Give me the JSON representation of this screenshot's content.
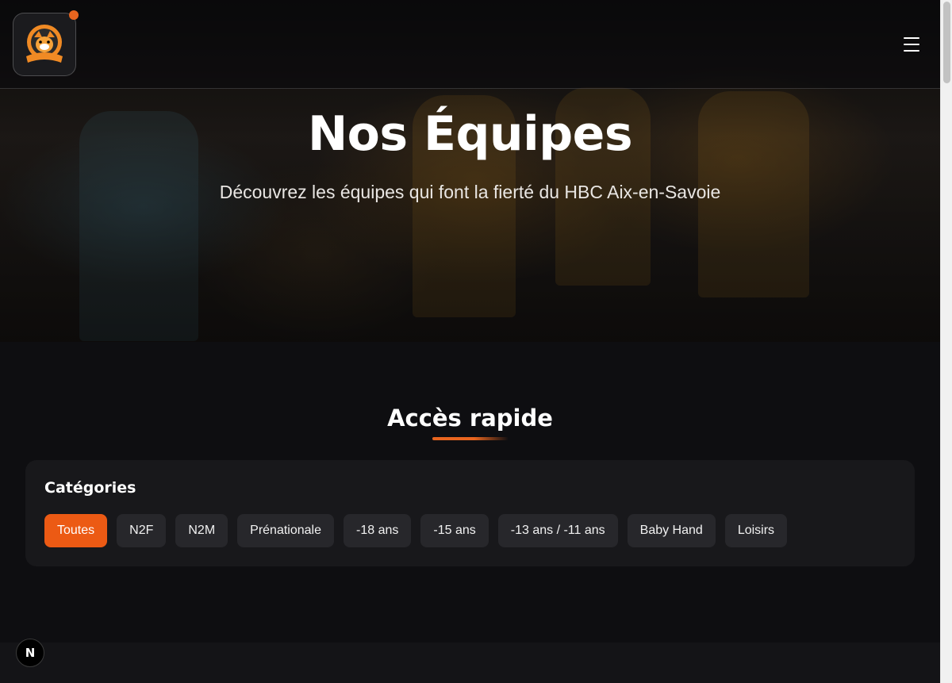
{
  "header": {
    "logo_icon": "tiger-club-logo-icon",
    "menu_icon": "hamburger-menu-icon"
  },
  "hero": {
    "title": "Nos Équipes",
    "subtitle": "Découvrez les équipes qui font la fierté du HBC Aix-en-Savoie"
  },
  "quick_access": {
    "title": "Accès rapide",
    "categories_label": "Catégories",
    "categories": [
      "Toutes",
      "N2F",
      "N2M",
      "Prénationale",
      "-18 ans",
      "-15 ans",
      "-13 ans / -11 ans",
      "Baby Hand",
      "Loisirs"
    ],
    "selected": "Toutes"
  },
  "dev_badge": {
    "label": "N"
  },
  "colors": {
    "accent": "#ec5a14",
    "background": "#0e0e11",
    "panel": "#18181b",
    "chip": "#27272b"
  }
}
